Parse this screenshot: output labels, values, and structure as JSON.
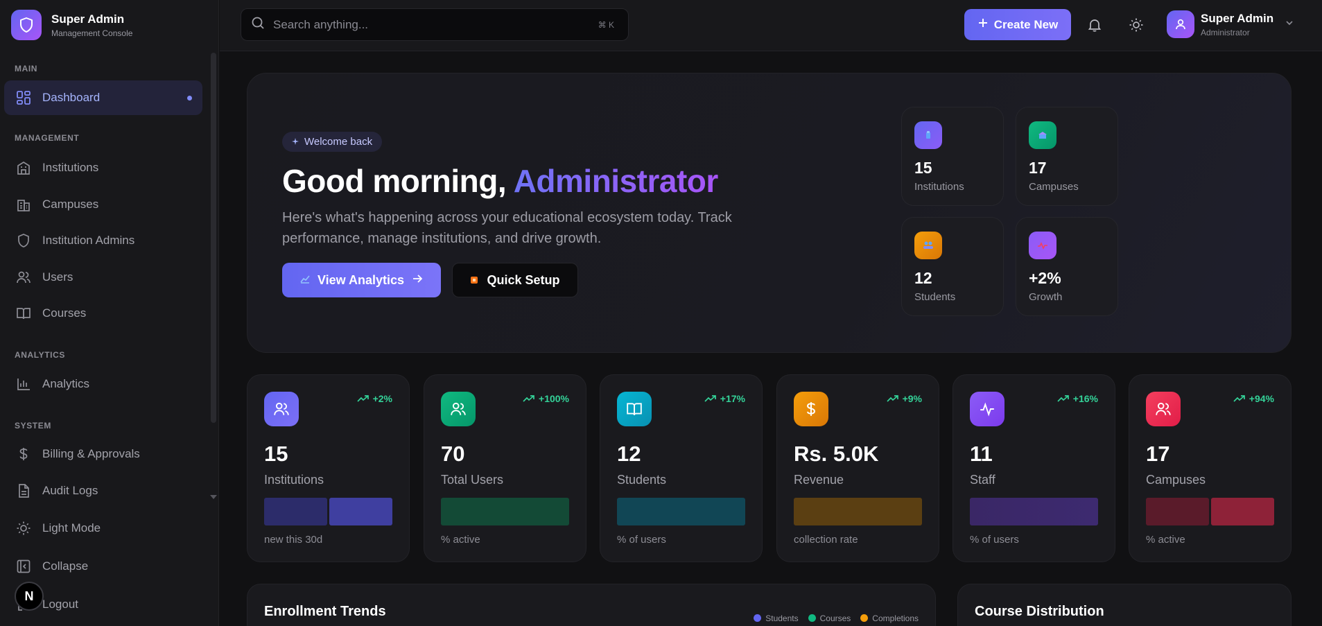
{
  "brand": {
    "title": "Super Admin",
    "subtitle": "Management Console"
  },
  "sidebar": {
    "sections": {
      "main": "MAIN",
      "management": "MANAGEMENT",
      "analytics": "ANALYTICS",
      "system": "SYSTEM"
    },
    "items": [
      {
        "label": "Dashboard",
        "icon": "dashboard-grid-icon"
      },
      {
        "label": "Institutions",
        "icon": "building-icon"
      },
      {
        "label": "Campuses",
        "icon": "campus-icon"
      },
      {
        "label": "Institution Admins",
        "icon": "shield-icon"
      },
      {
        "label": "Users",
        "icon": "users-icon"
      },
      {
        "label": "Courses",
        "icon": "book-icon"
      },
      {
        "label": "Analytics",
        "icon": "bar-chart-icon"
      },
      {
        "label": "Billing & Approvals",
        "icon": "dollar-icon"
      },
      {
        "label": "Audit Logs",
        "icon": "document-icon"
      },
      {
        "label": "Light Mode",
        "icon": "sun-icon"
      },
      {
        "label": "Collapse",
        "icon": "collapse-icon"
      },
      {
        "label": "Logout",
        "icon": "logout-icon"
      }
    ],
    "badge": "N"
  },
  "topbar": {
    "search_placeholder": "Search anything...",
    "shortcut": "⌘ K",
    "create_label": "Create New",
    "user_name": "Super Admin",
    "user_role": "Administrator"
  },
  "hero": {
    "pill": "Welcome back",
    "greeting": "Good morning, ",
    "name": "Administrator",
    "description": "Here's what's happening across your educational ecosystem today. Track performance, manage institutions, and drive growth.",
    "primary_button": "View Analytics",
    "secondary_button": "Quick Setup",
    "mini_stats": [
      {
        "value": "15",
        "label": "Institutions",
        "color": "#6366f1"
      },
      {
        "value": "17",
        "label": "Campuses",
        "color": "#10b981"
      },
      {
        "value": "12",
        "label": "Students",
        "color": "#f59e0b"
      },
      {
        "value": "+2%",
        "label": "Growth",
        "color": "#8b5cf6"
      }
    ]
  },
  "stats": [
    {
      "trend": "+2%",
      "value": "15",
      "label": "Institutions",
      "footer": "new this 30d",
      "color": "#6366f1"
    },
    {
      "trend": "+100%",
      "value": "70",
      "label": "Total Users",
      "footer": "% active",
      "color": "#10b981"
    },
    {
      "trend": "+17%",
      "value": "12",
      "label": "Students",
      "footer": "% of users",
      "color": "#06b6d4"
    },
    {
      "trend": "+9%",
      "value": "Rs. 5.0K",
      "label": "Revenue",
      "footer": "collection rate",
      "color": "#f59e0b"
    },
    {
      "trend": "+16%",
      "value": "11",
      "label": "Staff",
      "footer": "% of users",
      "color": "#8b5cf6"
    },
    {
      "trend": "+94%",
      "value": "17",
      "label": "Campuses",
      "footer": "% active",
      "color": "#f43f5e"
    }
  ],
  "panels": {
    "enrollment_title": "Enrollment Trends",
    "legend": [
      "Students",
      "Courses",
      "Completions"
    ],
    "legend_colors": [
      "#6366f1",
      "#10b981",
      "#f59e0b"
    ],
    "distribution_title": "Course Distribution"
  }
}
